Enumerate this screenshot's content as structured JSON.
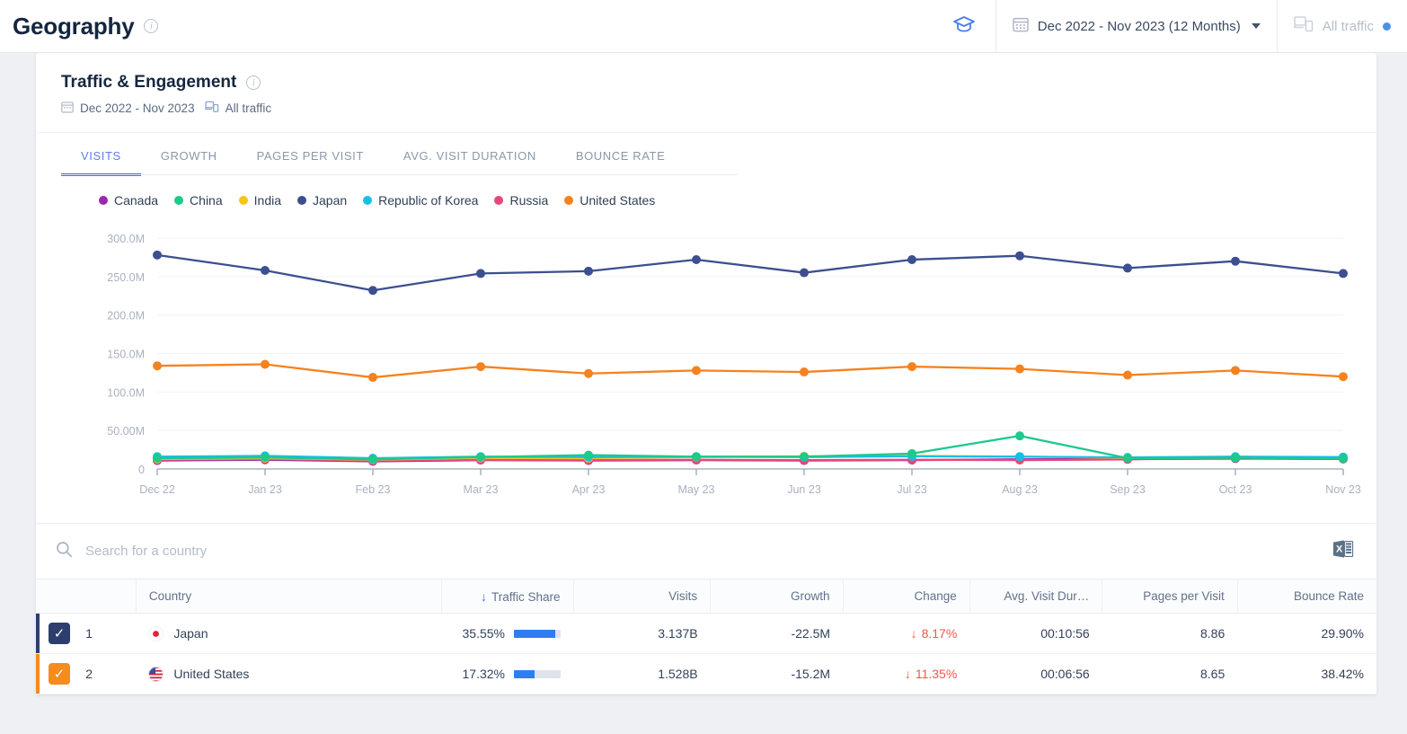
{
  "header": {
    "title": "Geography",
    "info_icon": "info-icon",
    "grad_icon": "graduation-cap-icon",
    "date_range": "Dec 2022 - Nov 2023 (12 Months)",
    "traffic_filter": "All traffic"
  },
  "card": {
    "title": "Traffic & Engagement",
    "date_range": "Dec 2022 - Nov 2023",
    "traffic_filter": "All traffic"
  },
  "tabs": [
    {
      "label": "VISITS",
      "active": true
    },
    {
      "label": "GROWTH",
      "active": false
    },
    {
      "label": "PAGES PER VISIT",
      "active": false
    },
    {
      "label": "AVG. VISIT DURATION",
      "active": false
    },
    {
      "label": "BOUNCE RATE",
      "active": false
    }
  ],
  "search": {
    "placeholder": "Search for a country",
    "value": ""
  },
  "export": {
    "label": "excel-export-icon"
  },
  "table": {
    "columns": [
      {
        "key": "check",
        "label": ""
      },
      {
        "key": "rank",
        "label": ""
      },
      {
        "key": "country",
        "label": "Country"
      },
      {
        "key": "share",
        "label": "Traffic Share",
        "sorted": true,
        "sort_dir": "desc"
      },
      {
        "key": "visits",
        "label": "Visits"
      },
      {
        "key": "growth",
        "label": "Growth"
      },
      {
        "key": "change",
        "label": "Change"
      },
      {
        "key": "avd",
        "label": "Avg. Visit Dur…"
      },
      {
        "key": "ppv",
        "label": "Pages per Visit"
      },
      {
        "key": "br",
        "label": "Bounce Rate"
      }
    ],
    "rows": [
      {
        "rank": "1",
        "country": "Japan",
        "flag": "flag-japan",
        "share": "35.55%",
        "share_pct": 35.55,
        "visits": "3.137B",
        "growth": "-22.5M",
        "change": "8.17%",
        "change_dir": "down",
        "avd": "00:10:56",
        "ppv": "8.86",
        "br": "29.90%",
        "accent": "#2c3e6b",
        "checked": true
      },
      {
        "rank": "2",
        "country": "United States",
        "flag": "flag-united-states",
        "share": "17.32%",
        "share_pct": 17.32,
        "visits": "1.528B",
        "growth": "-15.2M",
        "change": "11.35%",
        "change_dir": "down",
        "avd": "00:06:56",
        "ppv": "8.65",
        "br": "38.42%",
        "accent": "#f68b1f",
        "checked": true
      }
    ]
  },
  "chart_data": {
    "type": "line",
    "title": "Visits",
    "xlabel": "",
    "ylabel": "",
    "grid": true,
    "legend_position": "top",
    "x": [
      "Dec 22",
      "Jan 23",
      "Feb 23",
      "Mar 23",
      "Apr 23",
      "May 23",
      "Jun 23",
      "Jul 23",
      "Aug 23",
      "Sep 23",
      "Oct 23",
      "Nov 23"
    ],
    "ylim": [
      0,
      300000000
    ],
    "ytick_labels": [
      "300.0M",
      "250.0M",
      "200.0M",
      "150.0M",
      "100.0M",
      "50.00M",
      "0"
    ],
    "ytick_values": [
      300000000,
      250000000,
      200000000,
      150000000,
      100000000,
      50000000,
      0
    ],
    "series": [
      {
        "name": "Canada",
        "color": "#9b27b0",
        "values": [
          11000000,
          12000000,
          10000000,
          11500000,
          11000000,
          11500000,
          11000000,
          11500000,
          12500000,
          13000000,
          13500000,
          13000000
        ]
      },
      {
        "name": "China",
        "color": "#1ec98a",
        "values": [
          14000000,
          15000000,
          12500000,
          15500000,
          18000000,
          16000000,
          16000000,
          20000000,
          43000000,
          14000000,
          14500000,
          13500000
        ]
      },
      {
        "name": "India",
        "color": "#f7c51a",
        "values": [
          13000000,
          14000000,
          12000000,
          14500000,
          14000000,
          15500000,
          16500000,
          17000000,
          16000000,
          14500000,
          15000000,
          14000000
        ]
      },
      {
        "name": "Japan",
        "color": "#3c4f8f",
        "values": [
          278000000,
          258000000,
          232000000,
          254000000,
          257000000,
          272000000,
          255000000,
          272000000,
          277000000,
          261000000,
          270000000,
          254000000
        ]
      },
      {
        "name": "Republic of Korea",
        "color": "#15c0e6",
        "values": [
          16000000,
          17000000,
          14000000,
          16000000,
          15500000,
          16000000,
          15500000,
          16500000,
          16000000,
          15000000,
          16000000,
          15500000
        ]
      },
      {
        "name": "Russia",
        "color": "#e8467c",
        "values": [
          12000000,
          13000000,
          11000000,
          12000000,
          11500000,
          12000000,
          11500000,
          12000000,
          11500000,
          12500000,
          14000000,
          13000000
        ]
      },
      {
        "name": "United States",
        "color": "#f5821f",
        "values": [
          134000000,
          136000000,
          119000000,
          133000000,
          124000000,
          128000000,
          126000000,
          133000000,
          130000000,
          122000000,
          128000000,
          120000000
        ]
      }
    ]
  }
}
